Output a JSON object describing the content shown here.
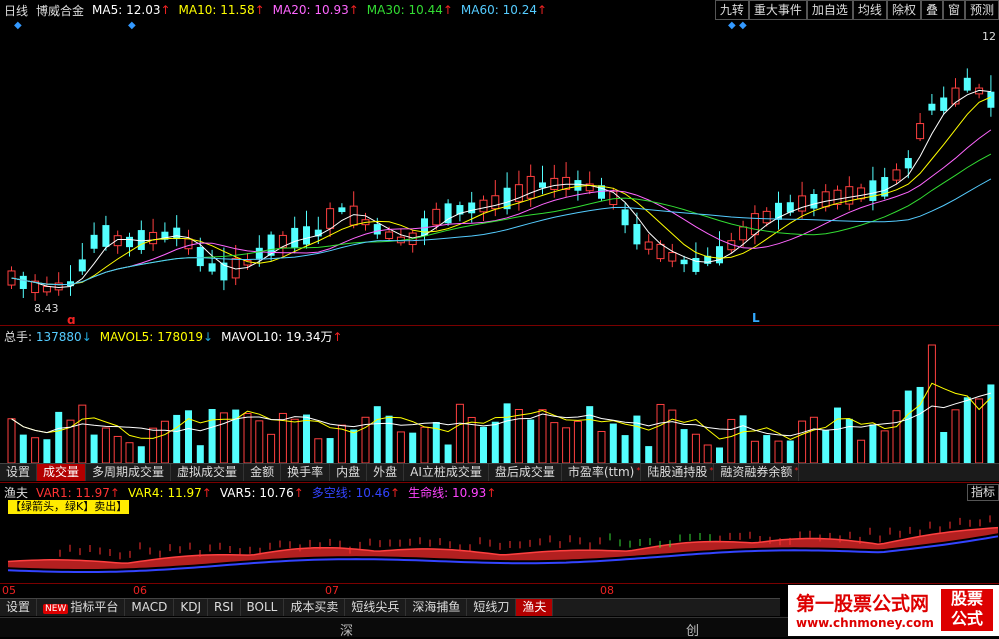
{
  "header": {
    "period": "日线",
    "stock_name": "博威合金",
    "ma": [
      {
        "label": "MA5:",
        "value": "12.03",
        "arrow": "↑",
        "color": "#ffffff"
      },
      {
        "label": "MA10:",
        "value": "11.58",
        "arrow": "↑",
        "color": "#ffff00"
      },
      {
        "label": "MA20:",
        "value": "10.93",
        "arrow": "↑",
        "color": "#ff66ff"
      },
      {
        "label": "MA30:",
        "value": "10.44",
        "arrow": "↑",
        "color": "#33dd33"
      },
      {
        "label": "MA60:",
        "value": "10.24",
        "arrow": "↑",
        "color": "#55ccff"
      }
    ],
    "buttons": [
      "九转",
      "重大事件",
      "加自选",
      "均线",
      "除权",
      "叠",
      "窗",
      "预测"
    ]
  },
  "main_chart": {
    "high_label": "12",
    "low_label": "8.43",
    "marker_q": "q",
    "marker_L": "L"
  },
  "volume": {
    "label": "总手:",
    "value": "137880",
    "value_arrow": "↓",
    "mavol5_label": "MAVOL5:",
    "mavol5_value": "178019",
    "mavol5_arrow": "↓",
    "mavol10_label": "MAVOL10:",
    "mavol10_value": "19.34万",
    "mavol10_arrow": "↑"
  },
  "vol_tabs": [
    "设置",
    "成交量",
    "多周期成交量",
    "虚拟成交量",
    "金额",
    "换手率",
    "内盘",
    "外盘",
    "AI立桩成交量",
    "盘后成交量",
    "市盈率(ttm)",
    "陆股通持股",
    "融资融券余额"
  ],
  "vol_active_tab": "成交量",
  "indicator": {
    "name": "渔夫",
    "vars": [
      {
        "label": "VAR1:",
        "value": "11.97",
        "arrow": "↑",
        "color": "#ff3333"
      },
      {
        "label": "VAR4:",
        "value": "11.97",
        "arrow": "↑",
        "color": "#ffff00"
      },
      {
        "label": "VAR5:",
        "value": "10.76",
        "arrow": "↑",
        "color": "#ffffff"
      },
      {
        "label": "多空线:",
        "value": "10.46",
        "arrow": "↑",
        "color": "#3344ff"
      },
      {
        "label": "生命线:",
        "value": "10.93",
        "arrow": "↑",
        "color": "#ff44ff"
      }
    ],
    "side_button": "指标",
    "note": "【绿箭头，绿K】卖出】"
  },
  "date_axis": [
    "05",
    "06",
    "07",
    "08"
  ],
  "bottom_tabs": [
    "设置",
    "指标平台",
    "MACD",
    "KDJ",
    "RSI",
    "BOLL",
    "成本买卖",
    "短线尖兵",
    "深海捕鱼",
    "短线刀",
    "渔夫"
  ],
  "bottom_new_tag": "NEW",
  "bottom_active_tab": "渔夫",
  "status_strip": [
    "深",
    "创"
  ],
  "watermark": {
    "line1": "第一股票公式网",
    "line2": "www.chnmoney.com",
    "badge1": "股票",
    "badge2": "公式"
  }
}
